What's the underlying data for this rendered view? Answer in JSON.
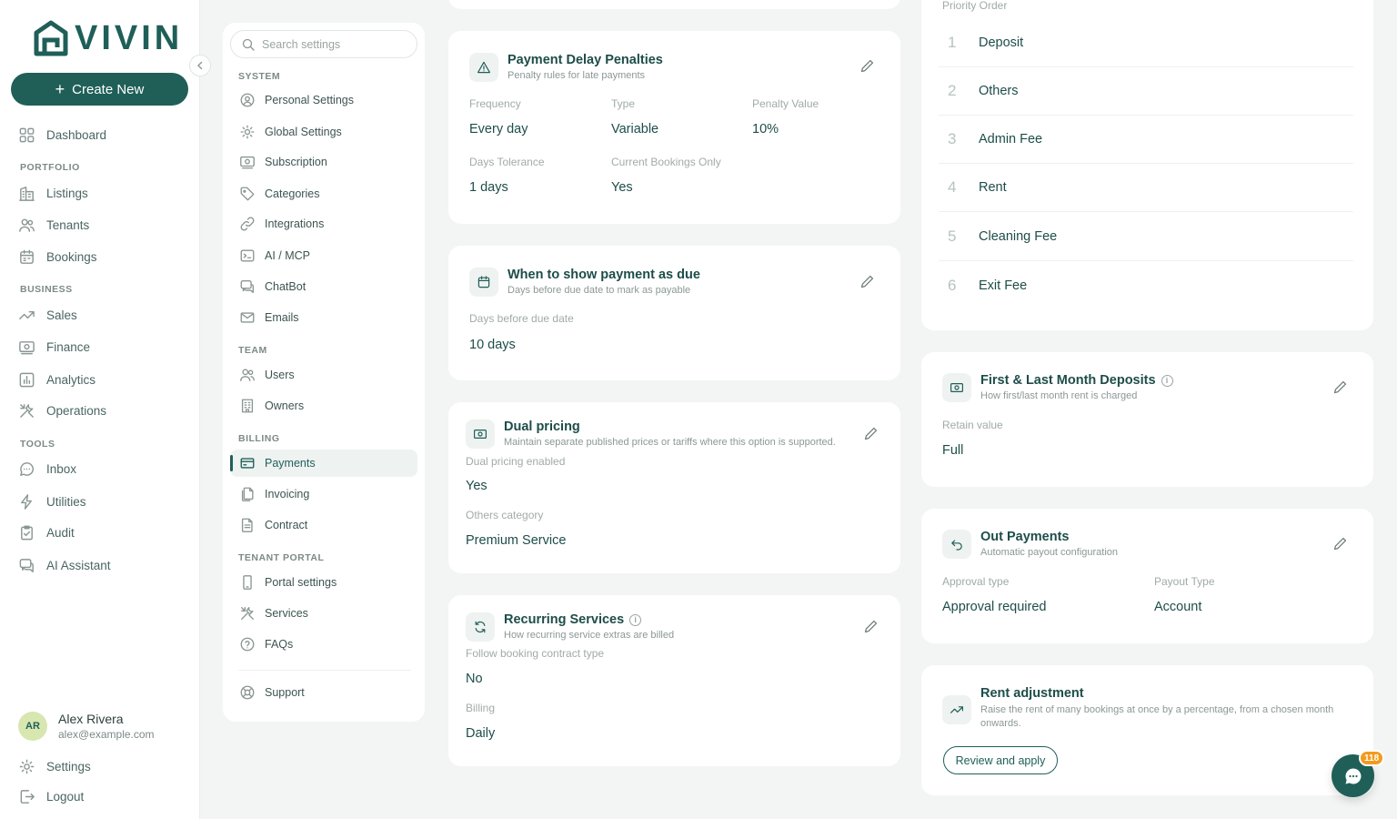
{
  "brand": {
    "name": "VIVIN"
  },
  "sidebar": {
    "create_label": "Create New",
    "dashboard": "Dashboard",
    "sections": {
      "portfolio": "PORTFOLIO",
      "business": "BUSINESS",
      "tools": "TOOLS"
    },
    "portfolio": [
      "Listings",
      "Tenants",
      "Bookings"
    ],
    "business": [
      "Sales",
      "Finance",
      "Analytics",
      "Operations"
    ],
    "tools": [
      "Inbox",
      "Utilities",
      "Audit",
      "AI Assistant"
    ],
    "user": {
      "initials": "AR",
      "name": "Alex Rivera",
      "email": "alex@example.com"
    },
    "settings": "Settings",
    "logout": "Logout"
  },
  "subnav": {
    "search_placeholder": "Search settings",
    "sections": {
      "system": "SYSTEM",
      "team": "TEAM",
      "billing": "BILLING",
      "tenant_portal": "TENANT PORTAL"
    },
    "system": [
      "Personal Settings",
      "Global Settings",
      "Subscription",
      "Categories",
      "Integrations",
      "AI / MCP",
      "ChatBot",
      "Emails"
    ],
    "team": [
      "Users",
      "Owners"
    ],
    "billing": [
      "Payments",
      "Invoicing",
      "Contract"
    ],
    "tenant_portal": [
      "Portal settings",
      "Services",
      "FAQs"
    ],
    "support": "Support",
    "active": "Payments"
  },
  "cards": {
    "penalties": {
      "title": "Payment Delay Penalties",
      "subtitle": "Penalty rules for late payments",
      "fields": {
        "frequency": {
          "label": "Frequency",
          "value": "Every day"
        },
        "type": {
          "label": "Type",
          "value": "Variable"
        },
        "penalty_value": {
          "label": "Penalty Value",
          "value": "10%"
        },
        "days_tolerance": {
          "label": "Days Tolerance",
          "value": "1 days"
        },
        "current_only": {
          "label": "Current Bookings Only",
          "value": "Yes"
        }
      }
    },
    "due": {
      "title": "When to show payment as due",
      "subtitle": "Days before due date to mark as payable",
      "field": {
        "label": "Days before due date",
        "value": "10 days"
      }
    },
    "dual": {
      "title": "Dual pricing",
      "subtitle": "Maintain separate published prices or tariffs where this option is supported.",
      "enabled": {
        "label": "Dual pricing enabled",
        "value": "Yes"
      },
      "others": {
        "label": "Others category",
        "value": "Premium Service"
      }
    },
    "recurring": {
      "title": "Recurring Services",
      "subtitle": "How recurring service extras are billed",
      "follow": {
        "label": "Follow booking contract type",
        "value": "No"
      },
      "billing": {
        "label": "Billing",
        "value": "Daily"
      }
    },
    "priority": {
      "label": "Priority Order",
      "items": [
        {
          "num": "1",
          "label": "Deposit"
        },
        {
          "num": "2",
          "label": "Others"
        },
        {
          "num": "3",
          "label": "Admin Fee"
        },
        {
          "num": "4",
          "label": "Rent"
        },
        {
          "num": "5",
          "label": "Cleaning Fee"
        },
        {
          "num": "6",
          "label": "Exit Fee"
        }
      ]
    },
    "first_last": {
      "title": "First & Last Month Deposits",
      "subtitle": "How first/last month rent is charged",
      "field": {
        "label": "Retain value",
        "value": "Full"
      }
    },
    "out_payments": {
      "title": "Out Payments",
      "subtitle": "Automatic payout configuration",
      "approval": {
        "label": "Approval type",
        "value": "Approval required"
      },
      "payout": {
        "label": "Payout Type",
        "value": "Account"
      }
    },
    "rent_adj": {
      "title": "Rent adjustment",
      "subtitle": "Raise the rent of many bookings at once by a percentage, from a chosen month onwards.",
      "button": "Review and apply"
    }
  },
  "chat": {
    "badge": "118"
  },
  "colors": {
    "primary": "#1f5f58",
    "badge": "#f29b1d",
    "background": "#f3f5f4"
  }
}
